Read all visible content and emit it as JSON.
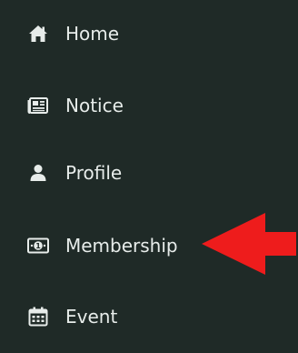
{
  "theme": {
    "sidebar_bg": "#1f2a27",
    "text_color": "#e7ecea",
    "icon_color": "#e7ecea",
    "annotation_arrow_color": "#ee1c1c"
  },
  "sidebar": {
    "items": [
      {
        "label": "Home",
        "icon": "home-icon"
      },
      {
        "label": "Notice",
        "icon": "newspaper-icon"
      },
      {
        "label": "Profile",
        "icon": "user-icon"
      },
      {
        "label": "Membership",
        "icon": "money-bill-icon"
      },
      {
        "label": "Event",
        "icon": "calendar-icon"
      }
    ]
  },
  "annotation": {
    "type": "arrow",
    "points_to": "Membership"
  }
}
